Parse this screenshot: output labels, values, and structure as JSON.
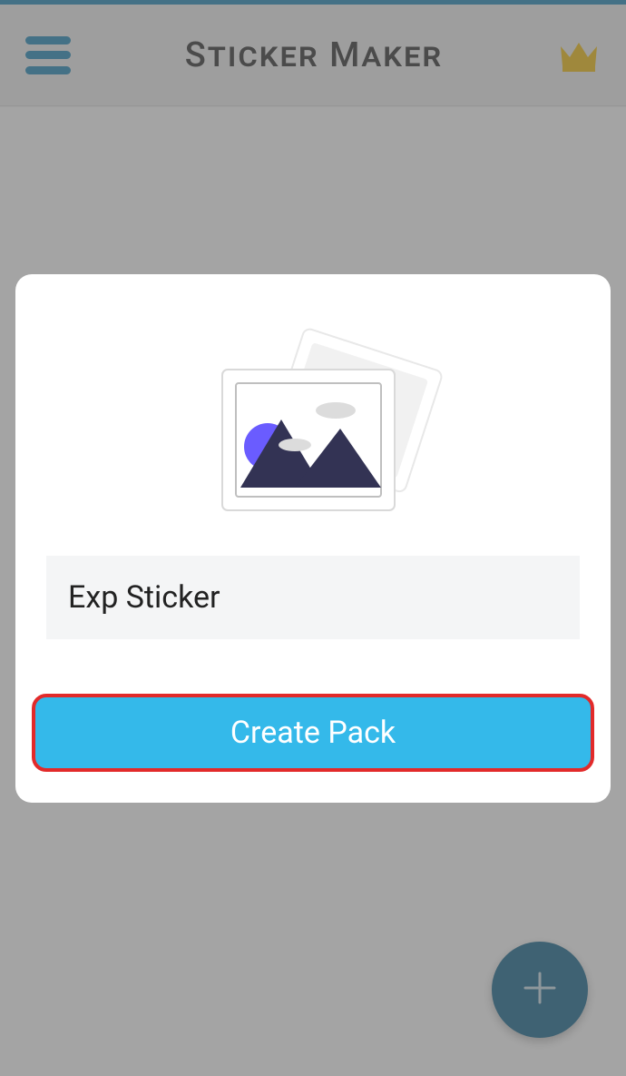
{
  "header": {
    "title": "Sticker Maker",
    "menu_icon": "menu",
    "crown_icon": "crown"
  },
  "fab": {
    "icon": "plus"
  },
  "modal": {
    "illustration": "image-stack",
    "pack_name_value": "Exp Sticker",
    "create_label": "Create Pack"
  },
  "colors": {
    "accent": "#2a8fbd",
    "fab": "#1f6e92",
    "button": "#34b9ea",
    "button_highlight_border": "#e22a2a",
    "crown": "#f3c21a"
  }
}
